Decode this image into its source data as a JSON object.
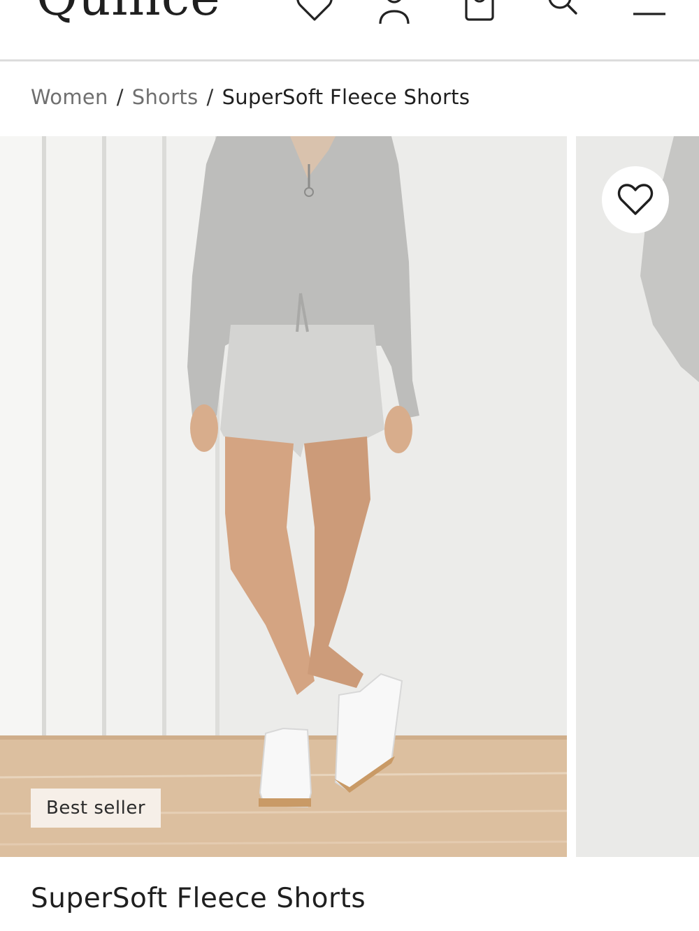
{
  "header": {
    "logo": "Quince",
    "icons": [
      "heart-icon",
      "user-icon",
      "bag-icon",
      "search-icon",
      "menu-icon"
    ]
  },
  "breadcrumb": {
    "items": [
      "Women",
      "Shorts"
    ],
    "current": "SuperSoft Fleece Shorts"
  },
  "gallery": {
    "badge": "Best seller",
    "wishlist_icon": "heart-icon"
  },
  "product": {
    "title": "SuperSoft Fleece Shorts"
  },
  "colors": {
    "text": "#1f1f1f",
    "muted": "#6f6f6f",
    "badge_bg": "#f6efe8",
    "divider": "#dcdcdc"
  }
}
